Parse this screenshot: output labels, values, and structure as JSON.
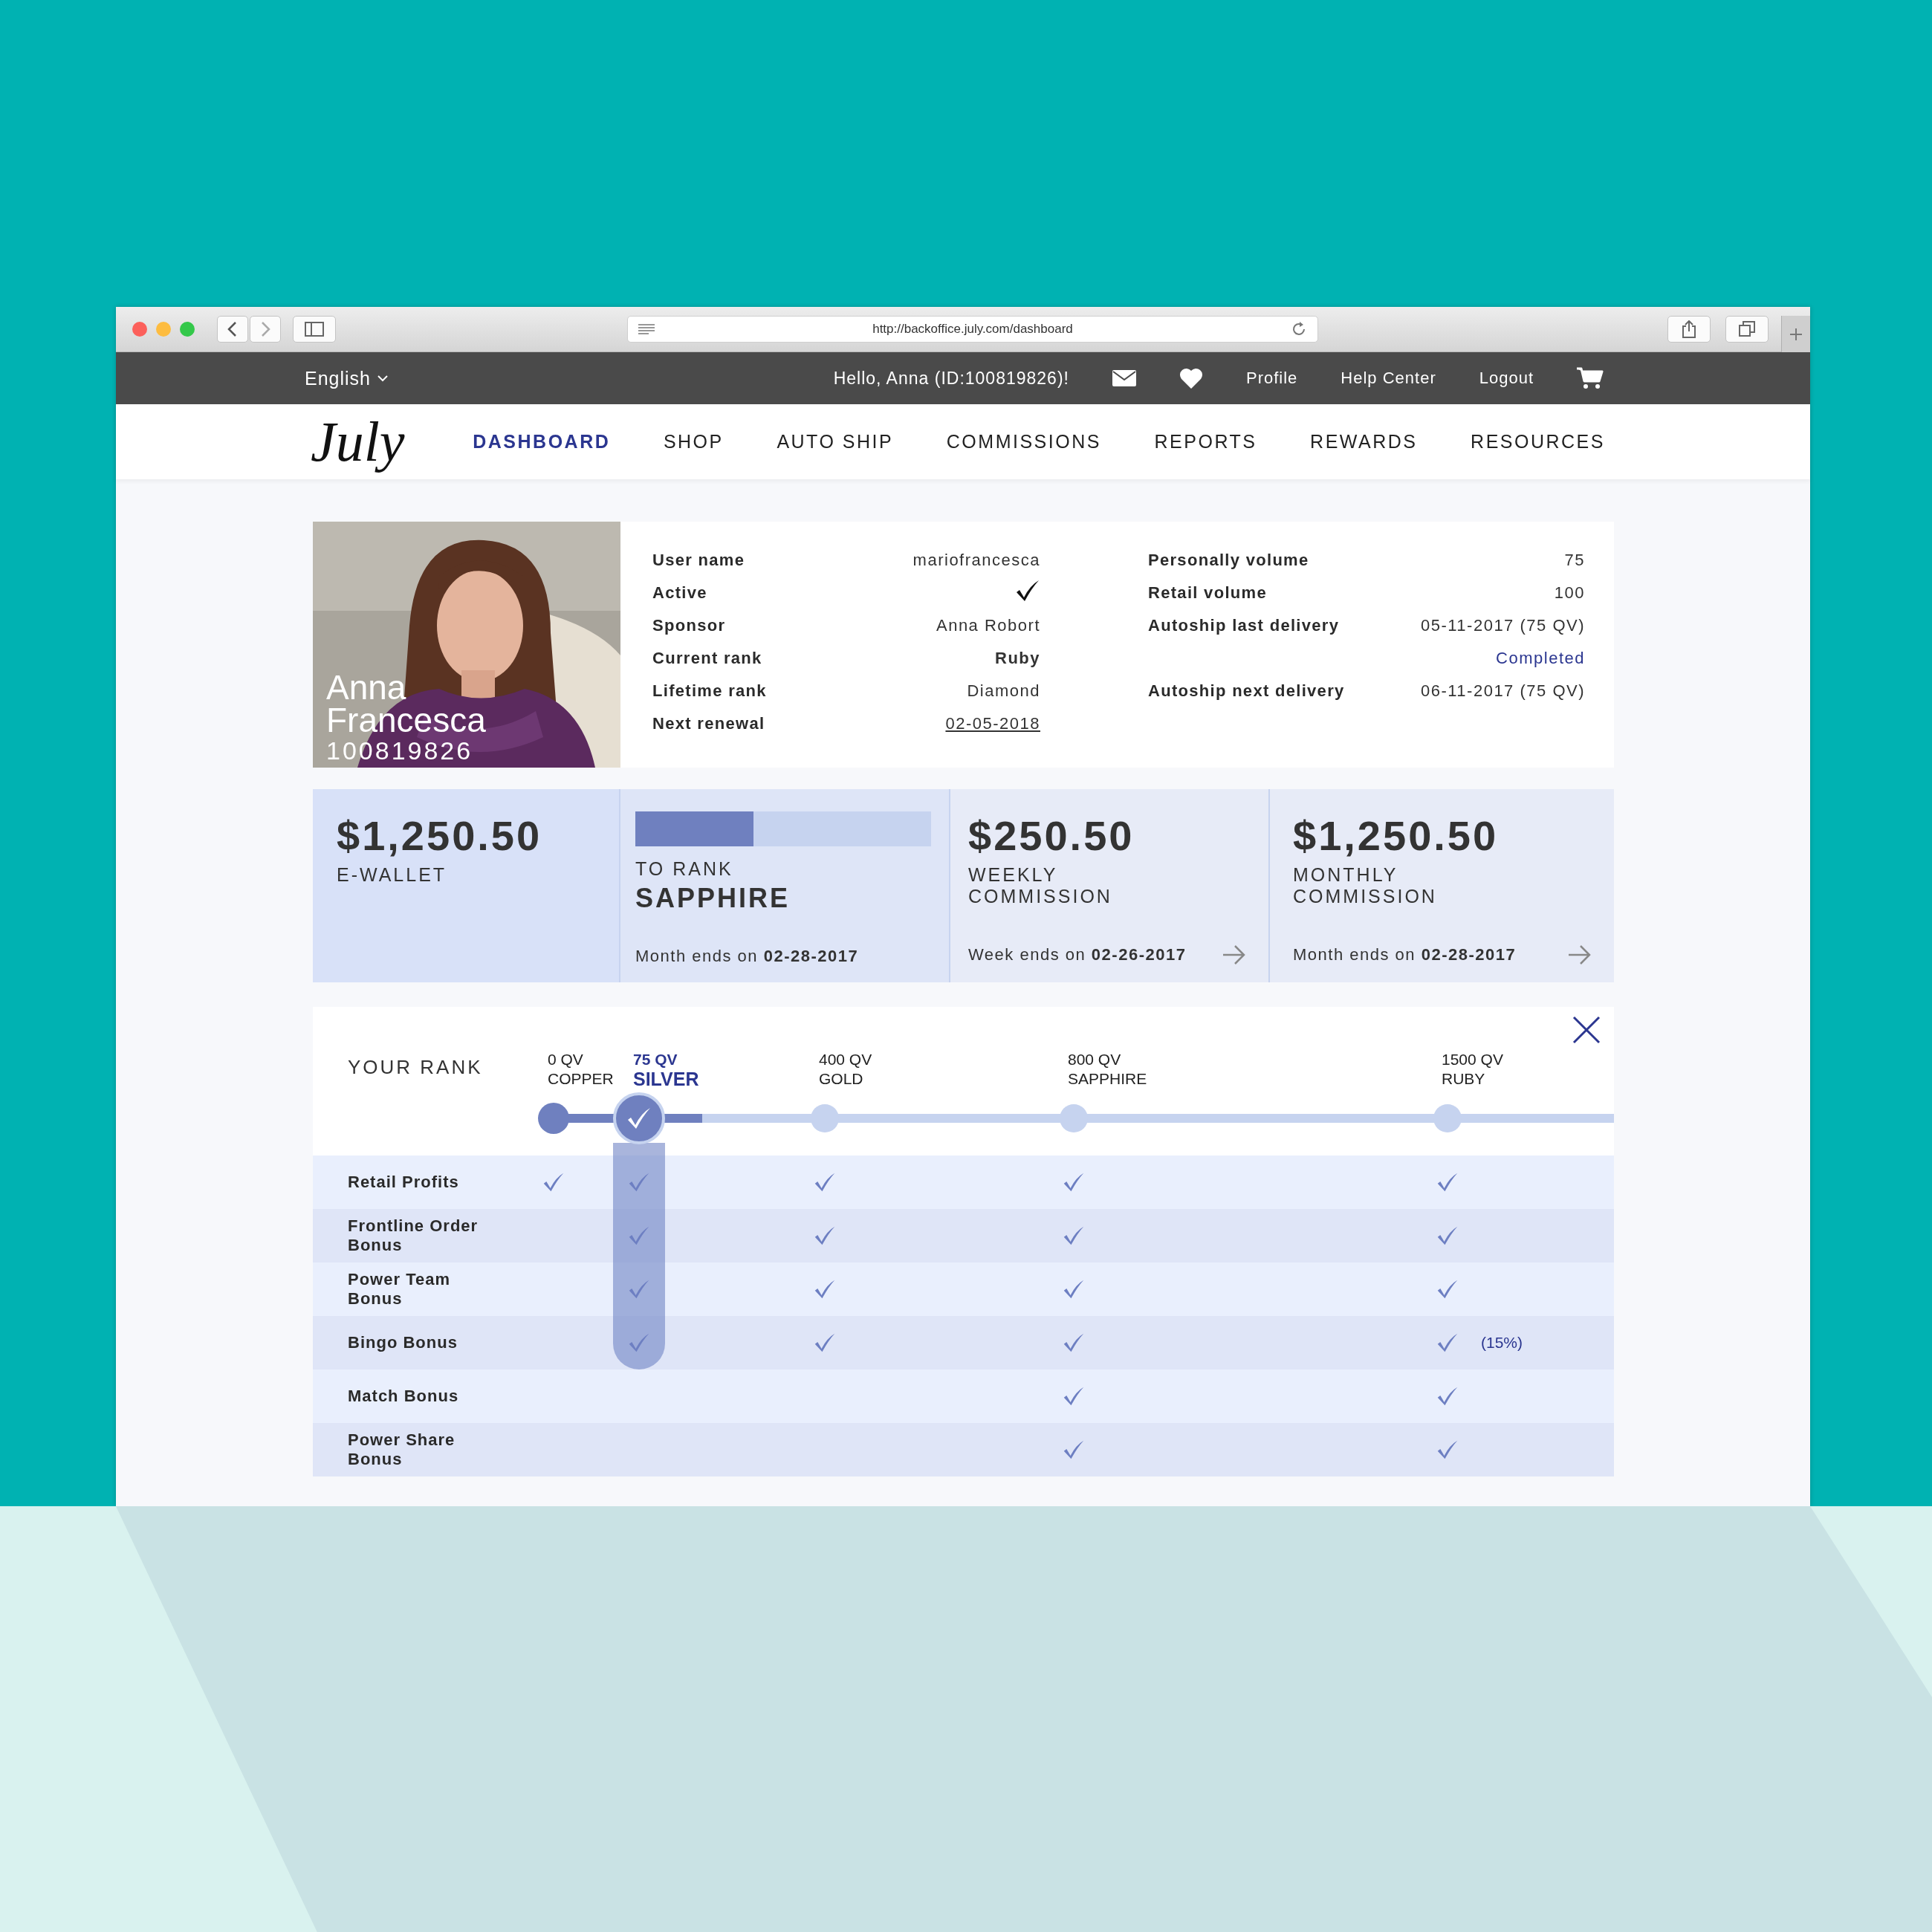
{
  "browser": {
    "url": "http://backoffice.july.com/dashboard"
  },
  "top_bar": {
    "language": "English",
    "greeting": "Hello, Anna (ID:100819826)!",
    "links": [
      "Profile",
      "Help Center",
      "Logout"
    ]
  },
  "nav": {
    "logo": "July",
    "items": [
      {
        "label": "DASHBOARD",
        "selected": true
      },
      {
        "label": "SHOP",
        "selected": false
      },
      {
        "label": "AUTO SHIP",
        "selected": false
      },
      {
        "label": "COMMISSIONS",
        "selected": false
      },
      {
        "label": "REPORTS",
        "selected": false
      },
      {
        "label": "REWARDS",
        "selected": false
      },
      {
        "label": "RESOURCES",
        "selected": false
      }
    ]
  },
  "profile": {
    "name": "Anna Francesca",
    "id": "100819826",
    "details": [
      {
        "label": "User name",
        "kind": "text",
        "value": "mariofrancesca"
      },
      {
        "label": "Active",
        "kind": "check",
        "checked": true
      },
      {
        "label": "Sponsor",
        "kind": "text",
        "value": "Anna Robort"
      },
      {
        "label": "Current rank",
        "kind": "bold",
        "value": "Ruby"
      },
      {
        "label": "Lifetime rank",
        "kind": "text",
        "value": "Diamond"
      },
      {
        "label": "Next renewal",
        "kind": "link",
        "value": "02-05-2018"
      }
    ],
    "volumes": [
      {
        "label": "Personally volume",
        "value": "75"
      },
      {
        "label": "Retail volume",
        "value": "100"
      },
      {
        "label": "Autoship last delivery",
        "value": "05-11-2017 (75 QV)",
        "status": "Completed"
      },
      {
        "label": "Autoship next delivery",
        "value": "06-11-2017 (75 QV)"
      }
    ]
  },
  "stats": [
    {
      "kind": "amount",
      "amount": "$1,250.50",
      "label": "E-WALLET"
    },
    {
      "kind": "progress",
      "level": 0.4,
      "label": "TO RANK",
      "rank": "SAPPHIRE",
      "footer": "Month ends on **02-28-2017**"
    },
    {
      "kind": "amount",
      "amount": "$250.50",
      "label": "WEEKLY COMMISSION",
      "footer": "Week ends on **02-26-2017**"
    },
    {
      "kind": "amount",
      "amount": "$1,250.50",
      "label": "MONTHLY COMMISSION",
      "footer": "Month ends on **02-28-2017**"
    }
  ],
  "rank_panel": {
    "title": "YOUR RANK",
    "track": {
      "level": 0.14
    },
    "ranks": [
      {
        "qv": "0 QV",
        "name": "COPPER",
        "reached": true,
        "selected": false
      },
      {
        "qv": "75 QV",
        "name": "SILVER",
        "reached": true,
        "selected": true
      },
      {
        "qv": "400 QV",
        "name": "GOLD",
        "reached": false,
        "selected": false
      },
      {
        "qv": "800 QV",
        "name": "SAPPHIRE",
        "reached": false,
        "selected": false
      },
      {
        "qv": "1500 QV",
        "name": "RUBY",
        "reached": false,
        "selected": false
      }
    ],
    "rows": [
      {
        "label": "Retail Profits",
        "cells": [
          {
            "checked": true
          },
          {
            "checked": true
          },
          {
            "checked": true
          },
          {
            "checked": true
          },
          {
            "checked": true
          }
        ]
      },
      {
        "label": "Frontline Order Bonus",
        "cells": [
          {
            "checked": false
          },
          {
            "checked": true
          },
          {
            "checked": true
          },
          {
            "checked": true
          },
          {
            "checked": true
          }
        ]
      },
      {
        "label": "Power Team Bonus",
        "cells": [
          {
            "checked": false
          },
          {
            "checked": true
          },
          {
            "checked": true
          },
          {
            "checked": true
          },
          {
            "checked": true
          }
        ]
      },
      {
        "label": "Bingo Bonus",
        "cells": [
          {
            "checked": false
          },
          {
            "checked": true
          },
          {
            "checked": true
          },
          {
            "checked": true
          },
          {
            "checked": true,
            "note": "(15%)"
          }
        ]
      },
      {
        "label": "Match Bonus",
        "cells": [
          {
            "checked": false
          },
          {
            "checked": false
          },
          {
            "checked": false
          },
          {
            "checked": true
          },
          {
            "checked": true
          }
        ]
      },
      {
        "label": "Power Share Bonus",
        "cells": [
          {
            "checked": false
          },
          {
            "checked": false
          },
          {
            "checked": false
          },
          {
            "checked": true
          },
          {
            "checked": true
          }
        ]
      }
    ]
  }
}
